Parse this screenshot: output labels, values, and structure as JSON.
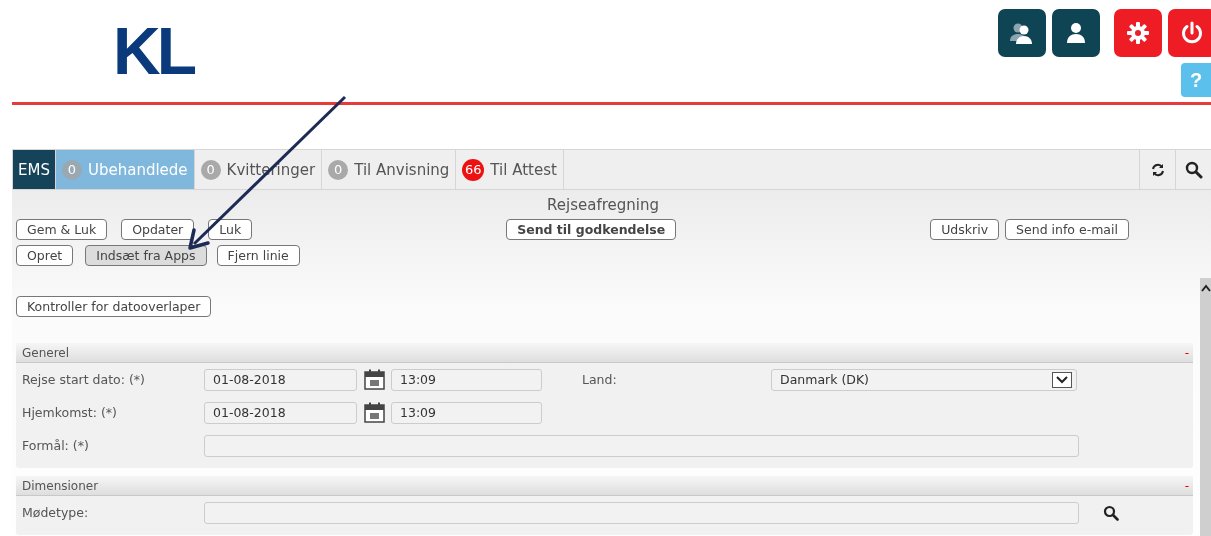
{
  "header": {
    "logo": "KL",
    "tools": [
      {
        "kind": "users"
      },
      {
        "kind": "user"
      },
      {
        "kind": "settings"
      },
      {
        "kind": "power"
      }
    ],
    "help": "?"
  },
  "tabs": [
    {
      "label": "EMS",
      "kind": "brand",
      "selected": false
    },
    {
      "count": "0",
      "label": "Ubehandlede",
      "kind": "queue",
      "alert": false,
      "selected": true
    },
    {
      "count": "0",
      "label": "Kvitteringer",
      "kind": "queue",
      "alert": false,
      "selected": false
    },
    {
      "count": "0",
      "label": "Til Anvisning",
      "kind": "queue",
      "alert": false,
      "selected": false
    },
    {
      "count": "66",
      "label": "Til Attest",
      "kind": "queue",
      "alert": true,
      "selected": false
    }
  ],
  "form_title": "Rejseafregning",
  "button_rows": [
    [
      {
        "label": "Gem & Luk",
        "kind": "normal"
      },
      {
        "label": "Opdater",
        "kind": "normal"
      },
      {
        "label": "Luk",
        "kind": "normal"
      },
      {
        "label": "Send til godkendelse",
        "kind": "bold"
      },
      {
        "label": "Udskriv",
        "kind": "normal"
      },
      {
        "label": "Send info e-mail",
        "kind": "normal"
      }
    ],
    [
      {
        "label": "Opret",
        "kind": "normal"
      },
      {
        "label": "Indsæt fra Apps",
        "kind": "pressed"
      },
      {
        "label": "Fjern linie",
        "kind": "normal"
      }
    ],
    [
      {
        "label": "Kontroller for datooverlaper",
        "kind": "normal"
      }
    ]
  ],
  "sections": [
    {
      "title": "Generel",
      "collapse": "-",
      "rows": [
        {
          "label": "Rejse start dato: (*)",
          "kind": "datetime",
          "date": "01-08-2018",
          "time": "13:09",
          "side_label": "Land:",
          "side_value": "Danmark (DK)"
        },
        {
          "label": "Hjemkomst: (*)",
          "kind": "datetime",
          "date": "01-08-2018",
          "time": "13:09"
        },
        {
          "label": "Formål: (*)",
          "kind": "text"
        }
      ]
    },
    {
      "title": "Dimensioner",
      "collapse": "-",
      "rows": [
        {
          "label": "Mødetype:",
          "kind": "lookup"
        }
      ]
    }
  ]
}
